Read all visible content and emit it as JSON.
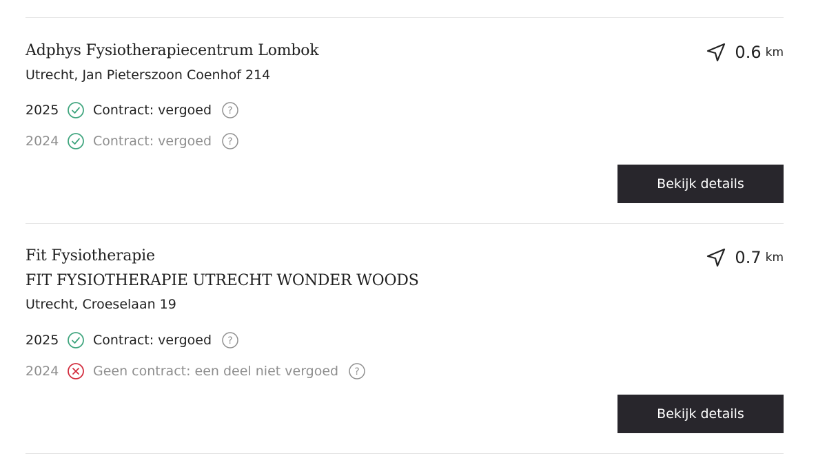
{
  "colors": {
    "check": "#3fa57e",
    "cross": "#d22c3d",
    "button_bg": "#28262c",
    "muted": "#8e8e8e"
  },
  "results": [
    {
      "name_line1": "Adphys Fysiotherapiecentrum Lombok",
      "address": "Utrecht, Jan Pieterszoon Coenhof 214",
      "distance": "0.6",
      "distance_unit": "km",
      "contracts": [
        {
          "year": "2025",
          "status": "Contract: vergoed",
          "icon": "check-circle-icon"
        },
        {
          "year": "2024",
          "status": "Contract: vergoed",
          "icon": "check-circle-icon"
        }
      ],
      "button_label": "Bekijk details"
    },
    {
      "name_line1": "Fit Fysiotherapie",
      "name_line2": "FIT FYSIOTHERAPIE UTRECHT WONDER WOODS",
      "address": "Utrecht, Croeselaan 19",
      "distance": "0.7",
      "distance_unit": "km",
      "contracts": [
        {
          "year": "2025",
          "status": "Contract: vergoed",
          "icon": "check-circle-icon"
        },
        {
          "year": "2024",
          "status": "Geen contract: een deel niet vergoed",
          "icon": "x-circle-icon"
        }
      ],
      "button_label": "Bekijk details"
    }
  ]
}
